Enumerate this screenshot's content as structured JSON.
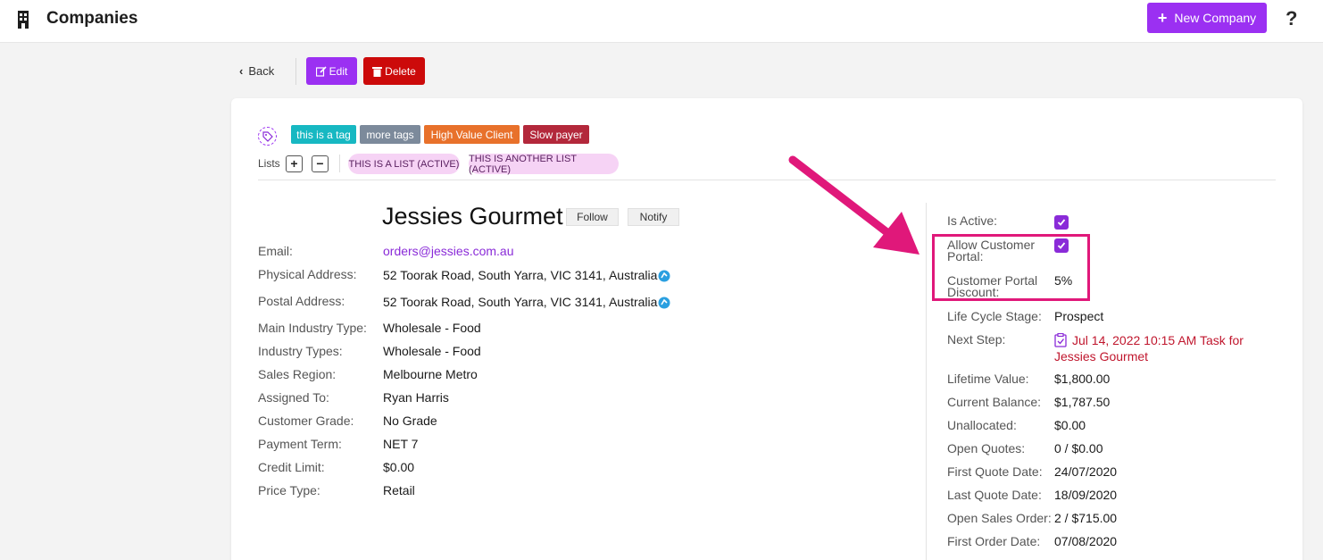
{
  "header": {
    "title": "Companies",
    "new_button": "New Company",
    "help": "?"
  },
  "toolbar": {
    "back": "Back",
    "edit": "Edit",
    "delete": "Delete"
  },
  "tags": [
    {
      "label": "this is a tag",
      "color": "#17b8c2"
    },
    {
      "label": "more tags",
      "color": "#7c8a9b"
    },
    {
      "label": "High Value Client",
      "color": "#e8712b"
    },
    {
      "label": "Slow payer",
      "color": "#b3283b"
    }
  ],
  "lists": {
    "label": "Lists",
    "add": "+",
    "remove": "−",
    "items": [
      "THIS IS A LIST (ACTIVE)",
      "THIS IS ANOTHER LIST (ACTIVE)"
    ]
  },
  "company": {
    "name": "Jessies Gourmet",
    "follow": "Follow",
    "notify": "Notify"
  },
  "details": [
    {
      "label": "Email:",
      "value": "orders@jessies.com.au"
    },
    {
      "label": "Physical Address:",
      "value": "52 Toorak Road, South Yarra, VIC 3141, Australia"
    },
    {
      "label": "Postal Address:",
      "value": "52 Toorak Road, South Yarra, VIC 3141, Australia"
    },
    {
      "label": "Main Industry Type:",
      "value": "Wholesale - Food"
    },
    {
      "label": "Industry Types:",
      "value": "Wholesale - Food"
    },
    {
      "label": "Sales Region:",
      "value": "Melbourne Metro"
    },
    {
      "label": "Assigned To:",
      "value": "Ryan Harris"
    },
    {
      "label": "Customer Grade:",
      "value": "No Grade"
    },
    {
      "label": "Payment Term:",
      "value": "NET 7"
    },
    {
      "label": "Credit Limit:",
      "value": "$0.00"
    },
    {
      "label": "Price Type:",
      "value": "Retail"
    }
  ],
  "side": {
    "is_active": {
      "label": "Is Active:",
      "checked": true
    },
    "portal": {
      "label_line1": "Allow Customer",
      "label_line2": "Portal:",
      "checked": true
    },
    "discount": {
      "label_line1": "Customer Portal",
      "label_line2": "Discount:",
      "value": "5%"
    },
    "life_cycle": {
      "label": "Life Cycle Stage:",
      "value": "Prospect"
    },
    "next_step": {
      "label": "Next Step:",
      "value": "Jul 14, 2022 10:15 AM Task for Jessies Gourmet"
    },
    "rows": [
      {
        "label": "Lifetime Value:",
        "value": "$1,800.00"
      },
      {
        "label": "Current Balance:",
        "value": "$1,787.50"
      },
      {
        "label": "Unallocated:",
        "value": "$0.00"
      },
      {
        "label": "Open Quotes:",
        "value": "0 / $0.00"
      },
      {
        "label": "First Quote Date:",
        "value": "24/07/2020"
      },
      {
        "label": "Last Quote Date:",
        "value": "18/09/2020"
      },
      {
        "label": "Open Sales Order:",
        "value": "2 / $715.00"
      },
      {
        "label": "First Order Date:",
        "value": "07/08/2020"
      }
    ]
  },
  "colors": {
    "accent": "#9b30f2",
    "danger": "#cc0a0a",
    "annotation": "#e0187a"
  },
  "icons": [
    "building-icon",
    "plus-icon",
    "help-icon",
    "chevron-left-icon",
    "edit-icon",
    "trash-icon",
    "tag-icon",
    "map-pin-icon",
    "check-icon",
    "task-icon",
    "annotation-arrow"
  ]
}
